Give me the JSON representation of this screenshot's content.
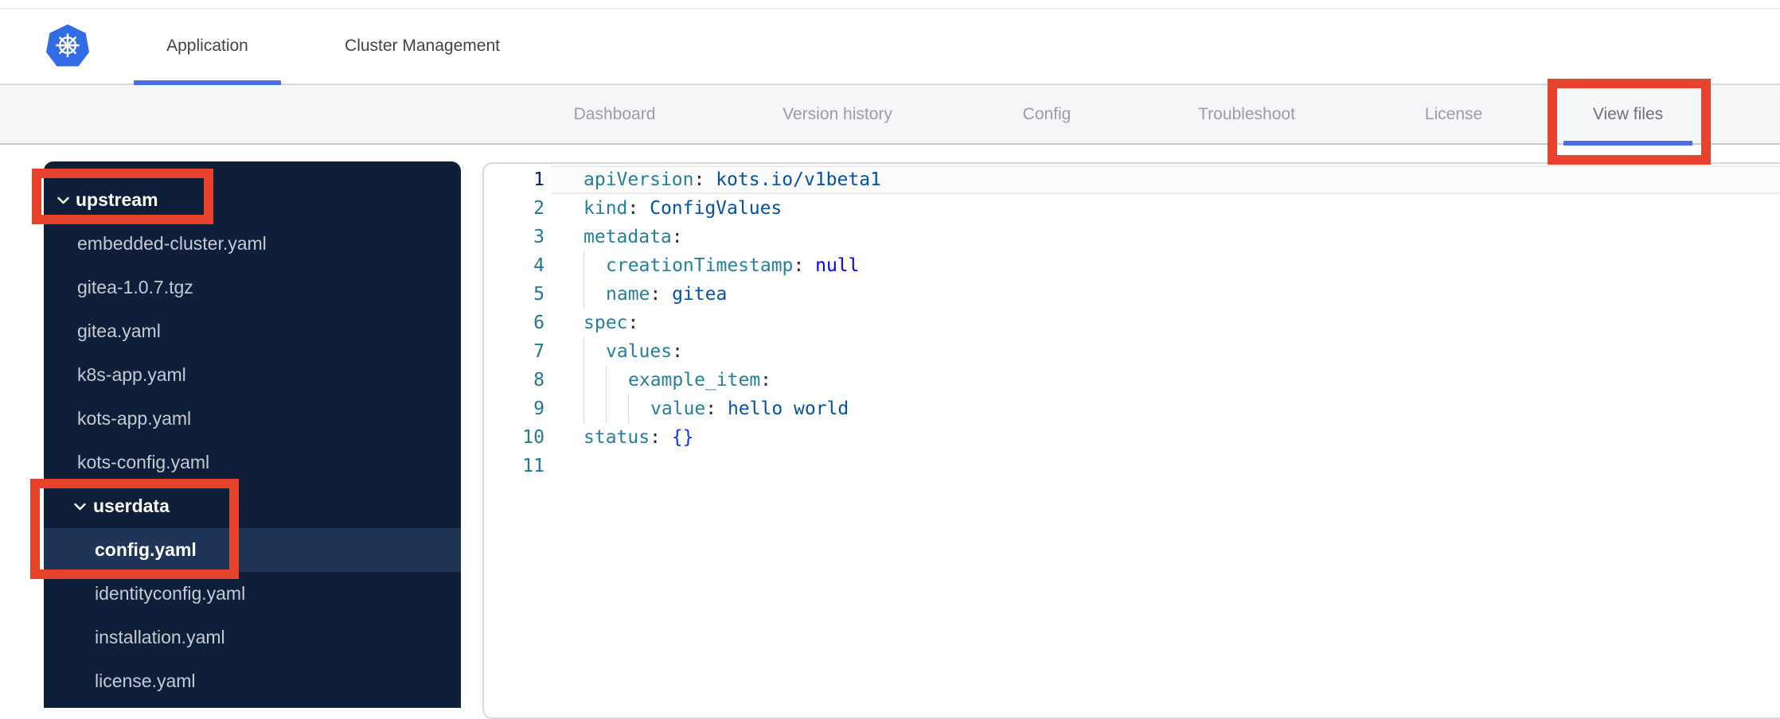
{
  "header": {
    "tabs": [
      {
        "label": "Application",
        "active": true
      },
      {
        "label": "Cluster Management",
        "active": false
      }
    ]
  },
  "subnav": {
    "items": [
      {
        "label": "Dashboard",
        "active": false
      },
      {
        "label": "Version history",
        "active": false
      },
      {
        "label": "Config",
        "active": false
      },
      {
        "label": "Troubleshoot",
        "active": false
      },
      {
        "label": "License",
        "active": false
      },
      {
        "label": "View files",
        "active": true
      }
    ]
  },
  "sidebar": {
    "items": [
      {
        "label": "upstream",
        "kind": "folder",
        "level": 0,
        "expanded": true,
        "selected": false
      },
      {
        "label": "embedded-cluster.yaml",
        "kind": "file",
        "level": 1,
        "selected": false
      },
      {
        "label": "gitea-1.0.7.tgz",
        "kind": "file",
        "level": 1,
        "selected": false
      },
      {
        "label": "gitea.yaml",
        "kind": "file",
        "level": 1,
        "selected": false
      },
      {
        "label": "k8s-app.yaml",
        "kind": "file",
        "level": 1,
        "selected": false
      },
      {
        "label": "kots-app.yaml",
        "kind": "file",
        "level": 1,
        "selected": false
      },
      {
        "label": "kots-config.yaml",
        "kind": "file",
        "level": 1,
        "selected": false
      },
      {
        "label": "userdata",
        "kind": "folder",
        "level": 1,
        "expanded": true,
        "selected": false
      },
      {
        "label": "config.yaml",
        "kind": "file",
        "level": 2,
        "selected": true
      },
      {
        "label": "identityconfig.yaml",
        "kind": "file",
        "level": 2,
        "selected": false
      },
      {
        "label": "installation.yaml",
        "kind": "file",
        "level": 2,
        "selected": false
      },
      {
        "label": "license.yaml",
        "kind": "file",
        "level": 2,
        "selected": false
      }
    ]
  },
  "editor": {
    "language": "yaml",
    "lines": [
      {
        "num": "1",
        "current": true,
        "guides": 0,
        "tokens": [
          [
            "key",
            "apiVersion"
          ],
          [
            "pn",
            ": "
          ],
          [
            "str",
            "kots.io/v1beta1"
          ]
        ]
      },
      {
        "num": "2",
        "current": false,
        "guides": 0,
        "tokens": [
          [
            "key",
            "kind"
          ],
          [
            "pn",
            ": "
          ],
          [
            "str",
            "ConfigValues"
          ]
        ]
      },
      {
        "num": "3",
        "current": false,
        "guides": 0,
        "tokens": [
          [
            "key",
            "metadata"
          ],
          [
            "pn",
            ":"
          ]
        ]
      },
      {
        "num": "4",
        "current": false,
        "guides": 1,
        "tokens": [
          [
            "key",
            "creationTimestamp"
          ],
          [
            "pn",
            ": "
          ],
          [
            "kw",
            "null"
          ]
        ]
      },
      {
        "num": "5",
        "current": false,
        "guides": 1,
        "tokens": [
          [
            "key",
            "name"
          ],
          [
            "pn",
            ": "
          ],
          [
            "str",
            "gitea"
          ]
        ]
      },
      {
        "num": "6",
        "current": false,
        "guides": 0,
        "tokens": [
          [
            "key",
            "spec"
          ],
          [
            "pn",
            ":"
          ]
        ]
      },
      {
        "num": "7",
        "current": false,
        "guides": 1,
        "tokens": [
          [
            "key",
            "values"
          ],
          [
            "pn",
            ":"
          ]
        ]
      },
      {
        "num": "8",
        "current": false,
        "guides": 2,
        "tokens": [
          [
            "key",
            "example_item"
          ],
          [
            "pn",
            ":"
          ]
        ]
      },
      {
        "num": "9",
        "current": false,
        "guides": 3,
        "tokens": [
          [
            "key",
            "value"
          ],
          [
            "pn",
            ": "
          ],
          [
            "str",
            "hello world"
          ]
        ]
      },
      {
        "num": "10",
        "current": false,
        "guides": 0,
        "tokens": [
          [
            "key",
            "status"
          ],
          [
            "pn",
            ": "
          ],
          [
            "br",
            "{}"
          ]
        ]
      },
      {
        "num": "11",
        "current": false,
        "guides": 0,
        "tokens": []
      }
    ]
  },
  "annotations": {
    "color": "#e7422b",
    "boxes": [
      "view-files-tab",
      "upstream-folder",
      "userdata-config-yaml"
    ]
  },
  "colors": {
    "accent_blue": "#4a6fe0",
    "logo_blue": "#326ce5",
    "sidebar_bg": "#0f1e39",
    "sidebar_selected_bg": "#1f3557",
    "code_key": "#267f99",
    "code_string": "#0451a5",
    "code_keyword": "#0000ff",
    "code_bracket": "#0431fa",
    "line_number": "#237893",
    "line_number_active": "#0b216f"
  }
}
